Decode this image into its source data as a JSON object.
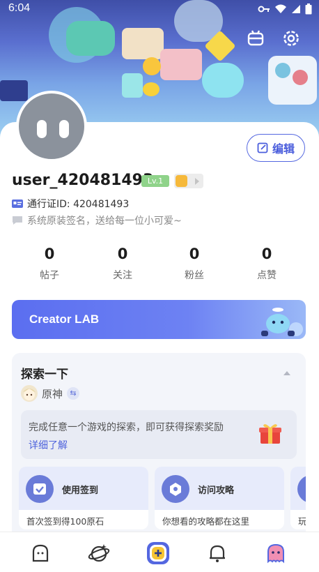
{
  "status_bar": {
    "time": "6:04"
  },
  "profile": {
    "username": "user_420481493",
    "level_badge": "Lv.1",
    "pass_id_label": "通行证ID: 420481493",
    "signature": "系统原装签名，送给每一位小可爱~",
    "edit_label": "编辑"
  },
  "stats": [
    {
      "value": "0",
      "label": "帖子"
    },
    {
      "value": "0",
      "label": "关注"
    },
    {
      "value": "0",
      "label": "粉丝"
    },
    {
      "value": "0",
      "label": "点赞"
    }
  ],
  "creator_banner": {
    "label": "Creator LAB"
  },
  "explore": {
    "title": "探索一下",
    "game_name": "原神",
    "swap_glyph": "⇆",
    "reward_text": "完成任意一个游戏的探索，即可获得探索奖励",
    "detail_link": "详细了解",
    "tasks": [
      {
        "name": "使用签到",
        "desc": "首次签到得100原石",
        "icon": "calendar-check-icon"
      },
      {
        "name": "访问攻略",
        "desc": "你想看的攻略都在这里",
        "icon": "guide-book-icon"
      },
      {
        "name": "",
        "desc": "玩",
        "icon": "task-icon"
      }
    ]
  },
  "bottom_nav": [
    {
      "id": "home",
      "icon": "home-ghost-icon"
    },
    {
      "id": "discover",
      "icon": "planet-icon"
    },
    {
      "id": "create",
      "icon": "add-post-icon"
    },
    {
      "id": "notifications",
      "icon": "bell-icon"
    },
    {
      "id": "me",
      "icon": "me-icon",
      "active": true
    }
  ],
  "colors": {
    "accent": "#5467e0",
    "level_green": "#8fd38a",
    "card_bg": "#f3f5fa"
  }
}
